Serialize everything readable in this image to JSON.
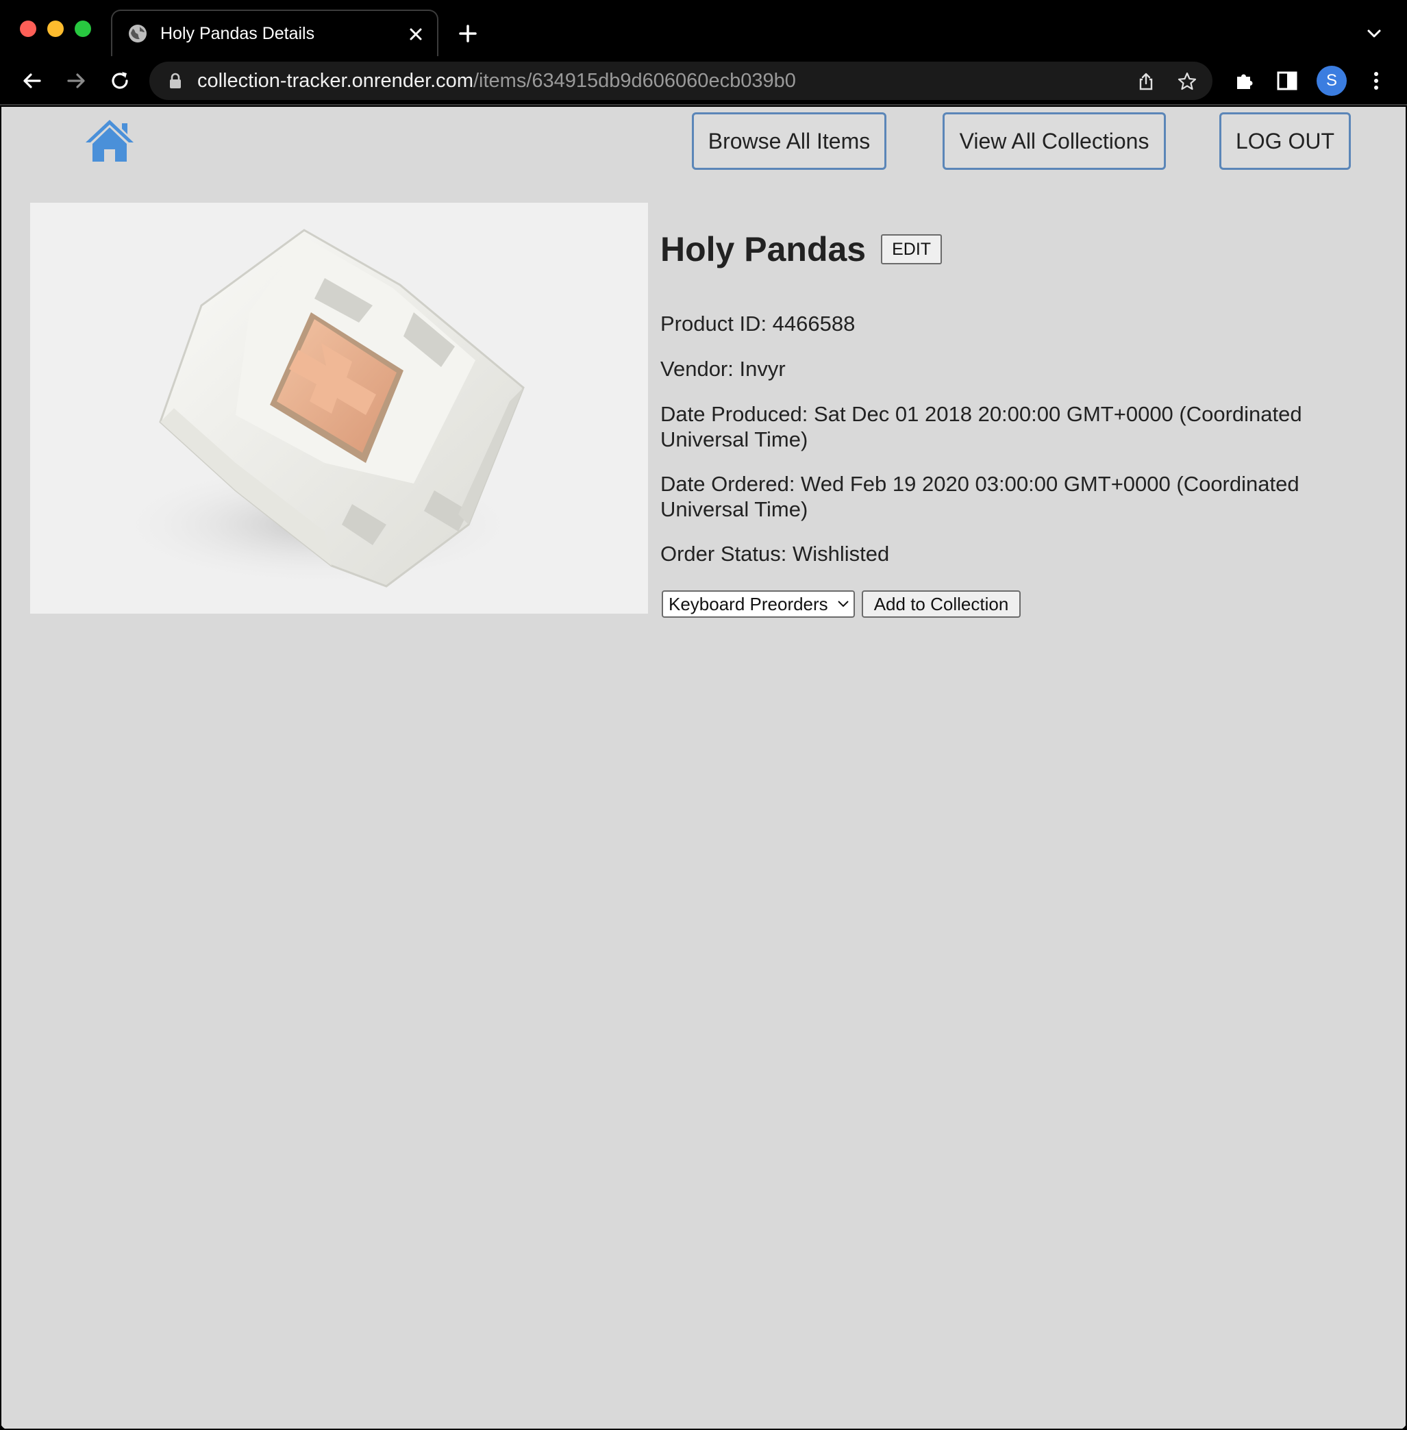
{
  "browser": {
    "tab_title": "Holy Pandas Details",
    "url_host": "collection-tracker.onrender.com",
    "url_path": "/items/634915db9d606060ecb039b0",
    "profile_initial": "S"
  },
  "nav": {
    "browse_label": "Browse All Items",
    "collections_label": "View All Collections",
    "logout_label": "LOG OUT"
  },
  "item": {
    "name": "Holy Pandas",
    "edit_label": "EDIT",
    "product_id": "Product ID: 4466588",
    "vendor": "Vendor: Invyr",
    "date_produced": "Date Produced: Sat Dec 01 2018 20:00:00 GMT+0000 (Coordinated Universal Time)",
    "date_ordered": "Date Ordered: Wed Feb 19 2020 03:00:00 GMT+0000 (Coordinated Universal Time)",
    "order_status": "Order Status: Wishlisted"
  },
  "add_to_collection": {
    "selected_collection": "Keyboard Preorders",
    "button_label": "Add to Collection"
  },
  "colors": {
    "page_bg": "#d9d9d9",
    "nav_border": "#5b86b8",
    "home_icon": "#4a90d9",
    "keycap": "#e9b08e"
  }
}
